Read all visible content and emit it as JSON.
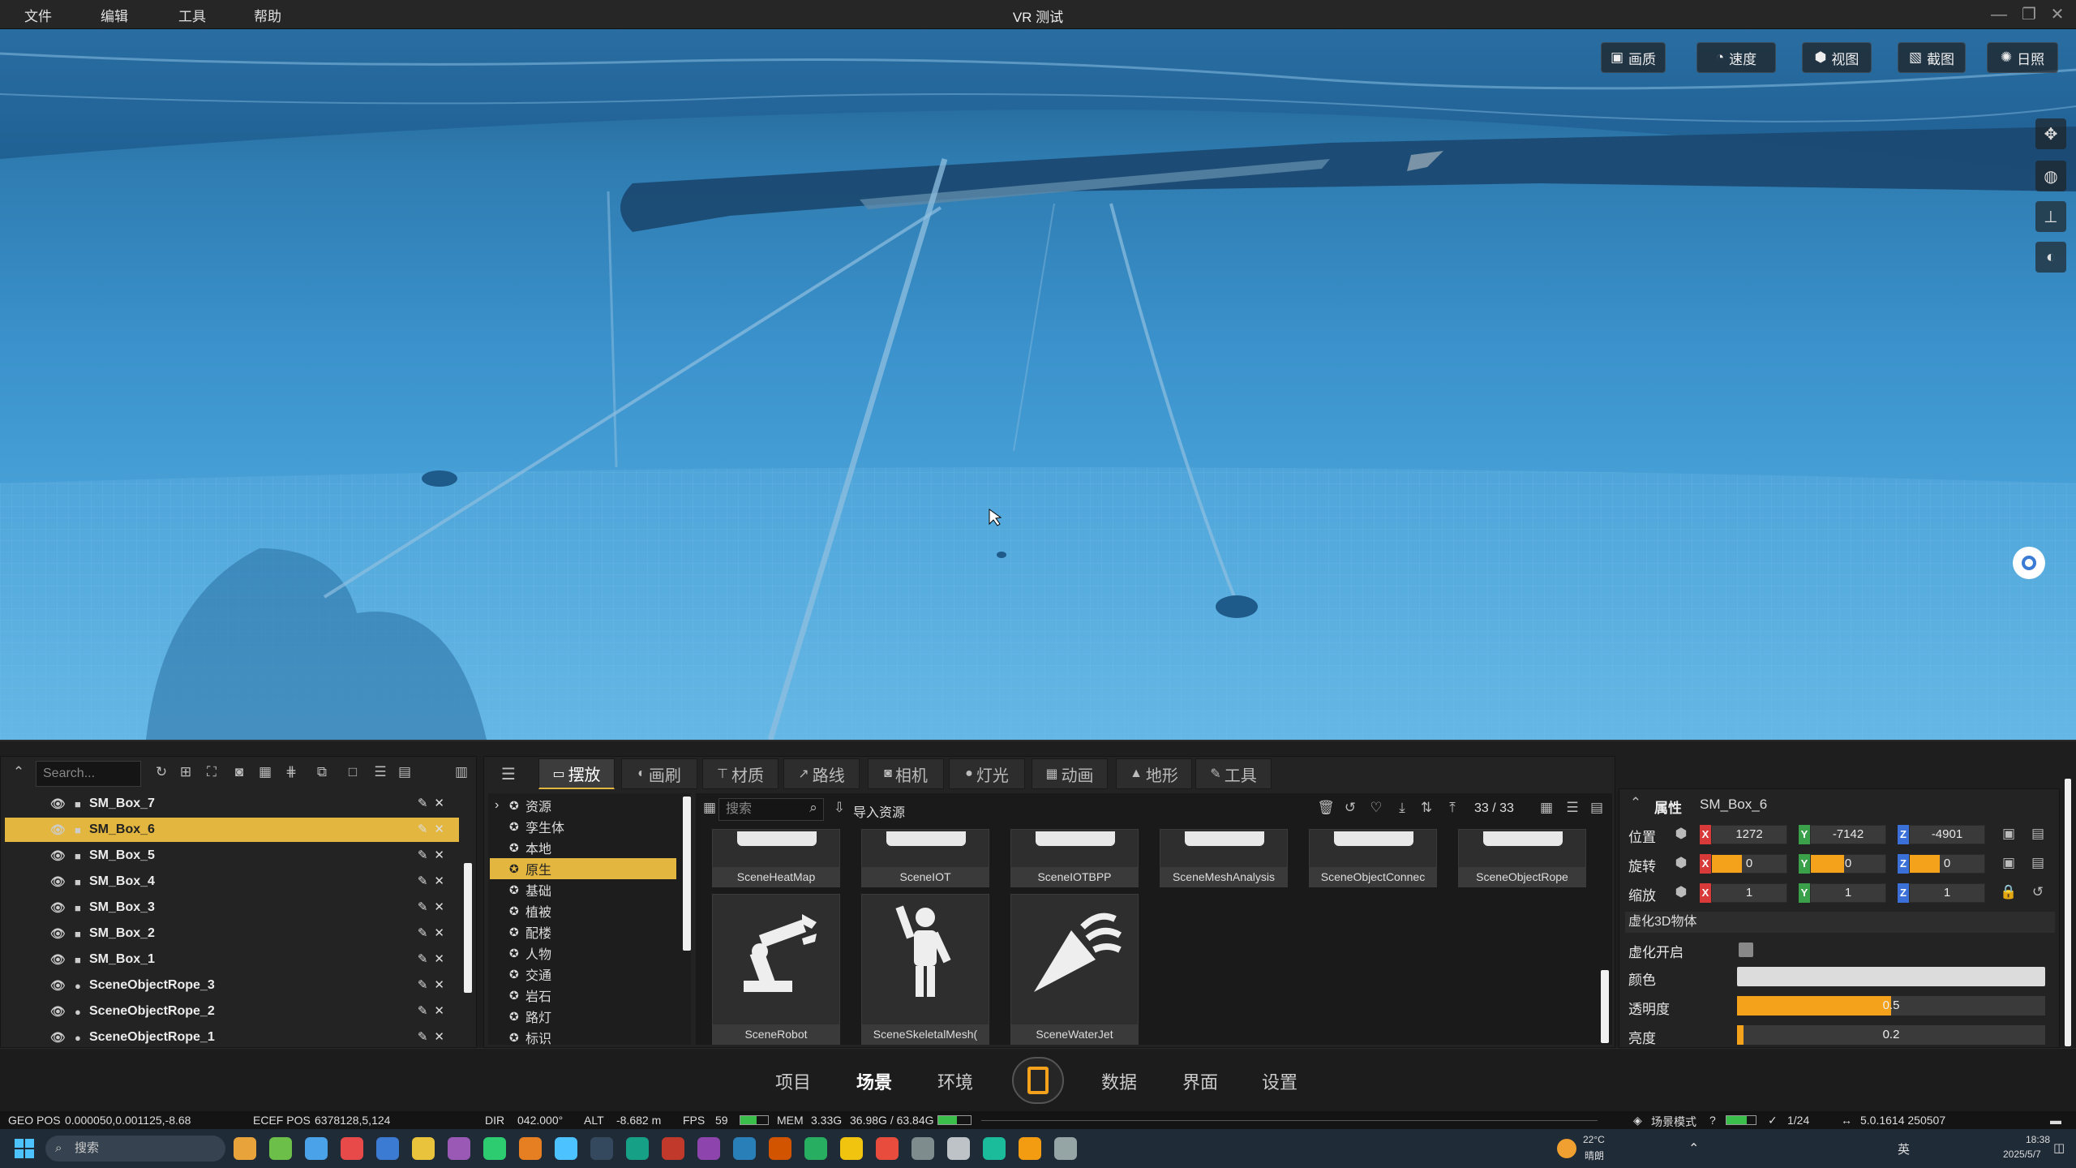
{
  "titlebar": {
    "menus": [
      "文件",
      "编辑",
      "工具",
      "帮助"
    ],
    "title": "VR 测试",
    "minimize": "—",
    "restore": "❐",
    "close": "✕"
  },
  "viewport_toolbar": [
    {
      "icon": "image-icon",
      "label": "画质"
    },
    {
      "icon": "speed-icon",
      "label": "速度"
    },
    {
      "icon": "cube-icon",
      "label": "视图"
    },
    {
      "icon": "screenshot-icon",
      "label": "截图"
    },
    {
      "icon": "sun-icon",
      "label": "日照"
    }
  ],
  "outliner": {
    "search_placeholder": "Search...",
    "items": [
      {
        "name": "SM_Box_7",
        "type": "mesh",
        "selected": false
      },
      {
        "name": "SM_Box_6",
        "type": "mesh",
        "selected": true
      },
      {
        "name": "SM_Box_5",
        "type": "mesh",
        "selected": false
      },
      {
        "name": "SM_Box_4",
        "type": "mesh",
        "selected": false
      },
      {
        "name": "SM_Box_3",
        "type": "mesh",
        "selected": false
      },
      {
        "name": "SM_Box_2",
        "type": "mesh",
        "selected": false
      },
      {
        "name": "SM_Box_1",
        "type": "mesh",
        "selected": false
      },
      {
        "name": "SceneObjectRope_3",
        "type": "rope",
        "selected": false
      },
      {
        "name": "SceneObjectRope_2",
        "type": "rope",
        "selected": false
      },
      {
        "name": "SceneObjectRope_1",
        "type": "rope",
        "selected": false
      }
    ]
  },
  "tabs": [
    {
      "icon": "layout-icon",
      "label": "摆放",
      "active": true
    },
    {
      "icon": "brush-icon",
      "label": "画刷"
    },
    {
      "icon": "material-icon",
      "label": "材质"
    },
    {
      "icon": "route-icon",
      "label": "路线"
    },
    {
      "icon": "camera-icon",
      "label": "相机"
    },
    {
      "icon": "light-icon",
      "label": "灯光"
    },
    {
      "icon": "animation-icon",
      "label": "动画"
    },
    {
      "icon": "terrain-icon",
      "label": "地形"
    },
    {
      "icon": "wrench-icon",
      "label": "工具"
    }
  ],
  "tree": [
    {
      "label": "资源",
      "arrow": "›"
    },
    {
      "label": "孪生体"
    },
    {
      "label": "本地"
    },
    {
      "label": "原生",
      "selected": true
    },
    {
      "label": "基础"
    },
    {
      "label": "植被"
    },
    {
      "label": "配楼"
    },
    {
      "label": "人物"
    },
    {
      "label": "交通"
    },
    {
      "label": "岩石"
    },
    {
      "label": "路灯"
    },
    {
      "label": "标识"
    }
  ],
  "assets": {
    "search_placeholder": "搜索",
    "import_label": "导入资源",
    "count": "33 / 33",
    "row1": [
      "SceneHeatMap",
      "SceneIOT",
      "SceneIOTBPP",
      "SceneMeshAnalysis",
      "SceneObjectConnec",
      "SceneObjectRope"
    ],
    "row2": [
      "SceneRobot",
      "SceneSkeletalMesh(",
      "SceneWaterJet"
    ]
  },
  "properties": {
    "header": "属性",
    "object": "SM_Box_6",
    "position_label": "位置",
    "rotation_label": "旋转",
    "scale_label": "缩放",
    "position": {
      "x": "1272",
      "y": "-7142",
      "z": "-4901"
    },
    "rotation": {
      "x": "0",
      "y": "0",
      "z": "0"
    },
    "scale": {
      "x": "1",
      "y": "1",
      "z": "1"
    },
    "section": "虚化3D物体",
    "enable_label": "虚化开启",
    "color_label": "颜色",
    "opacity_label": "透明度",
    "opacity_value": "0.5",
    "opacity": 0.5,
    "brightness_label": "亮度",
    "brightness_value": "0.2",
    "brightness": 0.02,
    "axis_x": "X",
    "axis_y": "Y",
    "axis_z": "Z"
  },
  "nav": [
    "项目",
    "场景",
    "环境",
    "数据",
    "界面",
    "设置"
  ],
  "nav_active": "场景",
  "status": {
    "geo_label": "GEO POS",
    "geo": "0.000050,0.001125,-8.68",
    "ecef_label": "ECEF POS",
    "ecef": "6378128,5,124",
    "dir_label": "DIR",
    "dir": "042.000°",
    "alt_label": "ALT",
    "alt": "-8.682 m",
    "fps_label": "FPS",
    "fps": "59",
    "mem_label": "MEM",
    "mem": "3.33G",
    "gpu": "36.98G / 63.84G",
    "mode": "场景模式",
    "page": "1/24",
    "version": "5.0.1614 250507"
  },
  "taskbar": {
    "search": "搜索",
    "weather_temp": "22°C",
    "weather_desc": "晴朗",
    "lang": "英",
    "time": "18:38",
    "date": "2025/5/7"
  },
  "colors": {
    "accent": "#e2b63f",
    "orange": "#f4a21b",
    "water": "#3b92cc"
  }
}
